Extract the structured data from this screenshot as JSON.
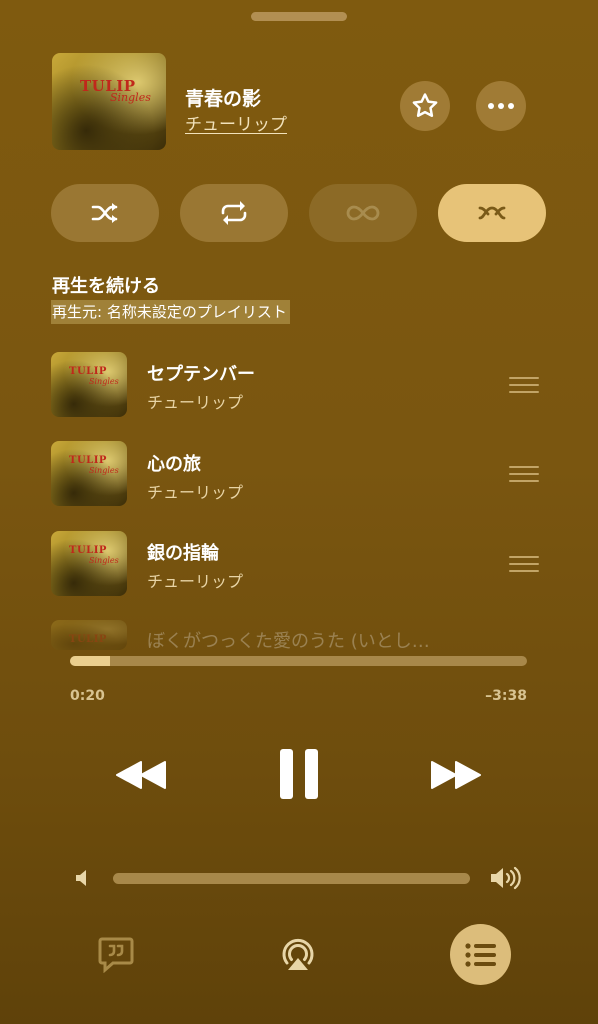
{
  "now_playing": {
    "title": "青春の影",
    "artist": "チューリップ",
    "artwork": {
      "line1": "TULIP",
      "line2": "Singles"
    }
  },
  "modes": [
    {
      "name": "shuffle",
      "icon": "shuffle-icon",
      "active": false
    },
    {
      "name": "repeat",
      "icon": "repeat-icon",
      "active": false
    },
    {
      "name": "infinity",
      "icon": "infinity-icon",
      "active": false
    },
    {
      "name": "autoplay",
      "icon": "autoplay-icon",
      "active": true
    }
  ],
  "continue_section": {
    "title": "再生を続ける",
    "subtitle": "再生元: 名称未設定のプレイリスト"
  },
  "queue": [
    {
      "title": "セプテンバー",
      "artist": "チューリップ"
    },
    {
      "title": "心の旅",
      "artist": "チューリップ"
    },
    {
      "title": "銀の指輪",
      "artist": "チューリップ"
    },
    {
      "title": "ぼくがつっくた愛のうた (いとし…",
      "artist": ""
    }
  ],
  "playback": {
    "elapsed": "0:20",
    "remaining": "–3:38",
    "progress_fraction": 0.087
  },
  "volume": {
    "level_fraction": 0.0
  },
  "colors": {
    "background": "#7a5610",
    "accent": "#e7c378",
    "track": "#a8884a"
  }
}
